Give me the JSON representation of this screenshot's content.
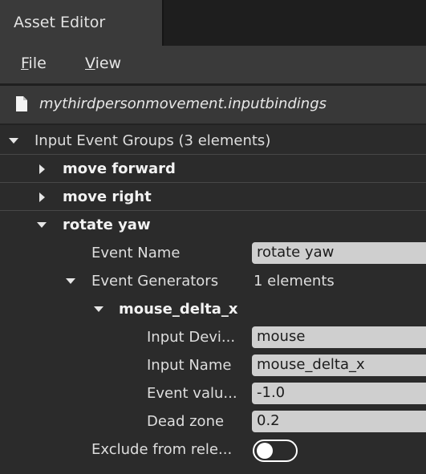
{
  "window": {
    "tab_title": "Asset Editor"
  },
  "menu": {
    "file_mnemonic": "F",
    "file_rest": "ile",
    "view_mnemonic": "V",
    "view_rest": "iew"
  },
  "file": {
    "name": "mythirdpersonmovement.inputbindings",
    "icon": "file-icon"
  },
  "tree": {
    "root_label": "Input Event Groups (3 elements)",
    "groups": [
      "move forward",
      "move right",
      "rotate yaw"
    ],
    "event_name_label": "Event Name",
    "event_name_value": "rotate yaw",
    "generators_label": "Event Generators",
    "generators_count": "1 elements",
    "generator_name": "mouse_delta_x",
    "input_device_label": "Input Devi...",
    "input_device_value": "mouse",
    "input_name_label": "Input Name",
    "input_name_value": "mouse_delta_x",
    "event_value_label": "Event valu...",
    "event_value_value": "-1.0",
    "dead_zone_label": "Dead zone",
    "dead_zone_value": "0.2",
    "exclude_label": "Exclude from rele...",
    "exclude_enabled": false
  }
}
